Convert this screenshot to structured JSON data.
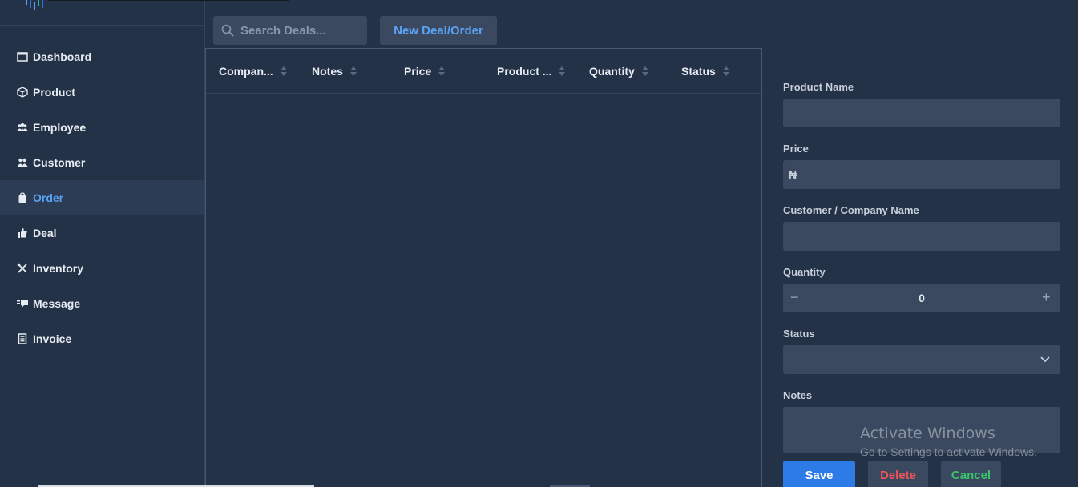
{
  "sidebar": {
    "items": [
      {
        "label": "Dashboard",
        "icon": "window-icon"
      },
      {
        "label": "Product",
        "icon": "cube-icon"
      },
      {
        "label": "Employee",
        "icon": "users-icon"
      },
      {
        "label": "Customer",
        "icon": "people-icon"
      },
      {
        "label": "Order",
        "icon": "bag-icon",
        "active": true
      },
      {
        "label": "Deal",
        "icon": "thumbs-up-icon"
      },
      {
        "label": "Inventory",
        "icon": "tools-icon"
      },
      {
        "label": "Message",
        "icon": "chat-icon"
      },
      {
        "label": "Invoice",
        "icon": "receipt-icon"
      }
    ]
  },
  "toolbar": {
    "search_placeholder": "Search Deals...",
    "new_button": "New Deal/Order"
  },
  "table": {
    "columns": [
      "Compan...",
      "Notes",
      "Price",
      "Product ...",
      "Quantity",
      "Status"
    ],
    "rows": []
  },
  "form": {
    "product_name_label": "Product Name",
    "price_label": "Price",
    "currency_symbol": "₦",
    "customer_label": "Customer / Company Name",
    "quantity_label": "Quantity",
    "quantity_value": "0",
    "minus": "−",
    "plus": "+",
    "status_label": "Status",
    "notes_label": "Notes",
    "save": "Save",
    "delete": "Delete",
    "cancel": "Cancel"
  },
  "watermark": {
    "title": "Activate Windows",
    "subtitle": "Go to Settings to activate Windows."
  },
  "colors": {
    "background": "#243247",
    "accent": "#5aa2f4",
    "save": "#2d7be6",
    "delete": "#f0535a",
    "cancel": "#39c46d"
  }
}
